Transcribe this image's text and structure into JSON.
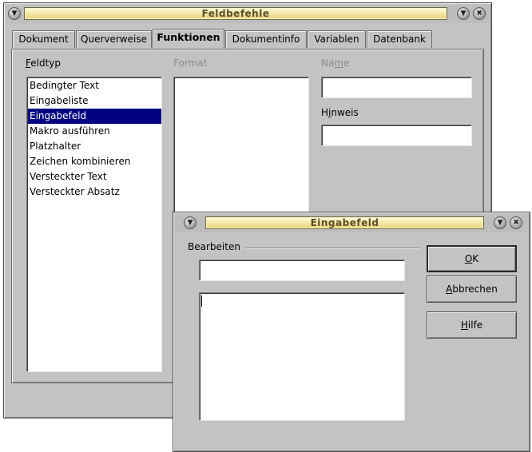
{
  "feldbefehle": {
    "title": "Feldbefehle",
    "tabs": [
      {
        "label": "Dokument"
      },
      {
        "label": "Querverweise"
      },
      {
        "label": "Funktionen"
      },
      {
        "label": "Dokumentinfo"
      },
      {
        "label": "Variablen"
      },
      {
        "label": "Datenbank"
      }
    ],
    "active_tab": "Funktionen",
    "feldtyp": {
      "label_mnemonic": "F",
      "label_rest": "eldtyp",
      "items": [
        {
          "label": "Bedingter Text"
        },
        {
          "label": "Eingabeliste"
        },
        {
          "label": "Eingabefeld"
        },
        {
          "label": "Makro ausführen"
        },
        {
          "label": "Platzhalter"
        },
        {
          "label": "Zeichen kombinieren"
        },
        {
          "label": "Versteckter Text"
        },
        {
          "label": "Versteckter Absatz"
        }
      ],
      "selected": "Eingabefeld"
    },
    "format_label": "Format",
    "name_label_pre": "Na",
    "name_label_mnemonic": "m",
    "name_label_post": "e",
    "name_value": "",
    "hinweis_label_pre": "H",
    "hinweis_label_mnemonic": "i",
    "hinweis_label_post": "nweis",
    "hinweis_value": ""
  },
  "eingabefeld": {
    "title": "Eingabefeld",
    "group_label": "Bearbeiten",
    "reference_value": "",
    "text_value": "",
    "ok_mnemonic": "O",
    "ok_rest": "K",
    "cancel_pre": "",
    "cancel_mnemonic": "A",
    "cancel_rest": "bbrechen",
    "help_mnemonic": "H",
    "help_rest": "ilfe"
  }
}
